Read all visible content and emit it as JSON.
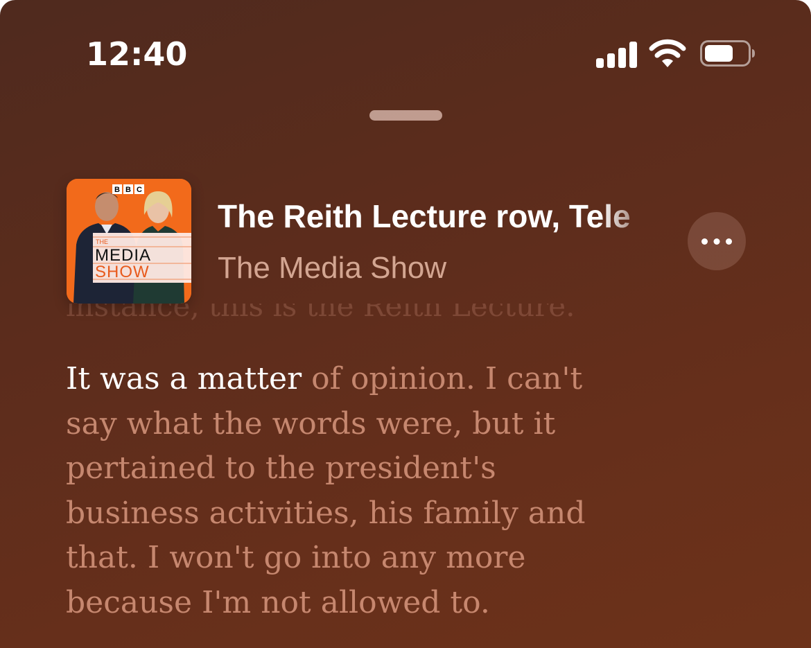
{
  "status_bar": {
    "time": "12:40",
    "icons": [
      "cellular-signal-icon",
      "wifi-icon",
      "battery-icon"
    ]
  },
  "header": {
    "episode_title": "The Reith Lecture row, Tele",
    "show_name": "The Media Show",
    "more_icon": "ellipsis-icon"
  },
  "artwork": {
    "brand": "BBC",
    "title_line1": "THE",
    "title_line2": "MEDIA",
    "title_line3": "SHOW"
  },
  "transcript": {
    "previous_line": "instance, this is the Reith Lecture.",
    "current_spoken": "It was a matter",
    "current_rest": " of opinion. I can't",
    "lines": [
      "say what the words were, but it",
      "pertained to the president's",
      "business activities, his family and",
      "that. I won't go into any more",
      "because I'm not allowed to."
    ]
  },
  "colors": {
    "background": "#5b2c1c",
    "accent_orange": "#f0681c",
    "highlight_text": "#ffffff",
    "dim_text": "#e2a087"
  }
}
